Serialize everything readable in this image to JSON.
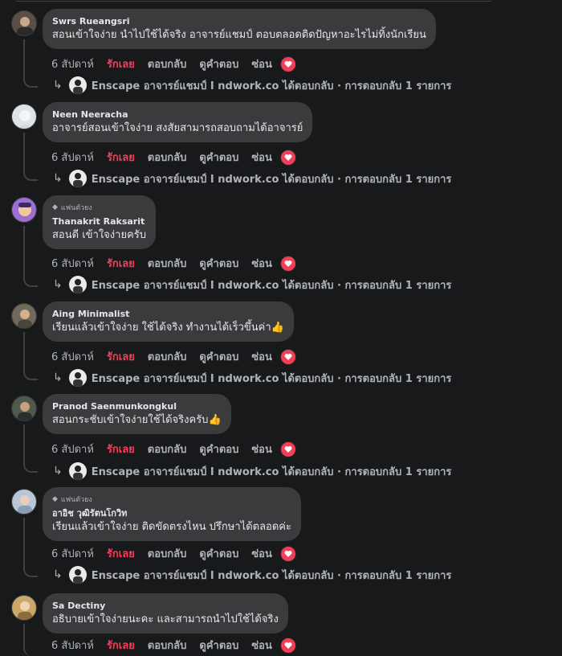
{
  "reactions": {
    "time": "6 สัปดาห์",
    "love": "รักเลย",
    "reply": "ตอบกลับ",
    "see_replies": "ดูคำตอบ",
    "hide": "ซ่อน"
  },
  "reply_summary": "Enscape อาจารย์แชมป์ I ndwork.co ได้ตอบกลับ · การตอบกลับ 1 รายการ",
  "fan_badge": "แฟนตัวยง",
  "comments": [
    {
      "author": "Swrs Rueangsri",
      "text": "สอนเข้าใจง่าย นำไปใช้ได้จริง อาจารย์แชมป์ ตอบตลอดติดปัญหาอะไรไม่ทิ้งนักเรียน",
      "emoji": ""
    },
    {
      "author": "Neen Neeracha",
      "text": "อาจารย์สอนเข้าใจง่าย สงสัยสามารถสอบถามได้อาจารย์",
      "emoji": ""
    },
    {
      "author": "Thanakrit Raksarit",
      "text": "สอนดี เข้าใจง่ายครับ",
      "emoji": ""
    },
    {
      "author": "Aing Minimalist",
      "text": "เรียนแล้วเข้าใจง่าย ใช้ได้จริง ทำงานได้เร็วขึ้นค่า",
      "emoji": "👍"
    },
    {
      "author": "Pranod Saenmunkongkul",
      "text": "สอนกระชับเข้าใจง่ายใช้ได้จริงครับ",
      "emoji": "👍"
    },
    {
      "author": "อาอิช วุฒิรัตนโกวิท",
      "text": "เรียนแล้วเข้าใจง่าย ติดขัดตรงไหน ปรึกษาได้ตลอดค่ะ",
      "emoji": ""
    },
    {
      "author": "Sa Dectiny",
      "text": "อธิบายเข้าใจง่ายนะคะ และสามารถนำไปใช้ได้จริง",
      "emoji": ""
    }
  ]
}
